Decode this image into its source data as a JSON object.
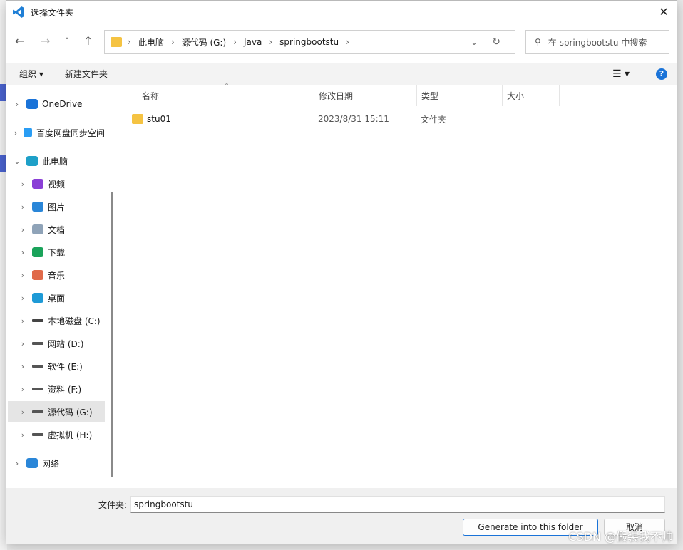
{
  "window": {
    "title": "选择文件夹",
    "close": "✕"
  },
  "nav": {
    "back": "←",
    "forward": "→",
    "recent": "˅",
    "up": "↑"
  },
  "address": {
    "crumbs": [
      "此电脑",
      "源代码 (G:)",
      "Java",
      "springbootstu"
    ]
  },
  "search": {
    "placeholder": "在 springbootstu 中搜索"
  },
  "toolbar": {
    "organize": "组织",
    "new_folder": "新建文件夹"
  },
  "sidebar": {
    "items": [
      {
        "label": "OneDrive",
        "icon": "cloud-icon",
        "color": "#1a73d8"
      },
      {
        "label": "百度网盘同步空间",
        "icon": "baidu-icon",
        "color": "#2a9df4"
      },
      {
        "label": "此电脑",
        "icon": "computer-icon",
        "color": "#1ea0c8"
      },
      {
        "label": "视频",
        "icon": "video-icon",
        "color": "#8a3fd6"
      },
      {
        "label": "图片",
        "icon": "pictures-icon",
        "color": "#2a86d8"
      },
      {
        "label": "文档",
        "icon": "documents-icon",
        "color": "#8fa3b8"
      },
      {
        "label": "下载",
        "icon": "download-icon",
        "color": "#1aa35a"
      },
      {
        "label": "音乐",
        "icon": "music-icon",
        "color": "#e06a4a"
      },
      {
        "label": "桌面",
        "icon": "desktop-icon",
        "color": "#1e9ad6"
      },
      {
        "label": "本地磁盘 (C:)",
        "icon": "drive-icon",
        "color": "#444"
      },
      {
        "label": "网站 (D:)",
        "icon": "drive-icon",
        "color": "#555"
      },
      {
        "label": "软件 (E:)",
        "icon": "drive-icon",
        "color": "#555"
      },
      {
        "label": "资料 (F:)",
        "icon": "drive-icon",
        "color": "#555"
      },
      {
        "label": "源代码 (G:)",
        "icon": "drive-icon",
        "color": "#555"
      },
      {
        "label": "虚拟机 (H:)",
        "icon": "drive-icon",
        "color": "#555"
      },
      {
        "label": "网络",
        "icon": "network-icon",
        "color": "#2a86d8"
      }
    ]
  },
  "columns": [
    "名称",
    "修改日期",
    "类型",
    "大小"
  ],
  "files": [
    {
      "name": "stu01",
      "date": "2023/8/31 15:11",
      "type": "文件夹",
      "size": ""
    }
  ],
  "footer": {
    "folder_label": "文件夹:",
    "folder_value": "springbootstu",
    "primary": "Generate into this folder",
    "cancel": "取消"
  },
  "watermark": "CSDN @假装我不帅"
}
